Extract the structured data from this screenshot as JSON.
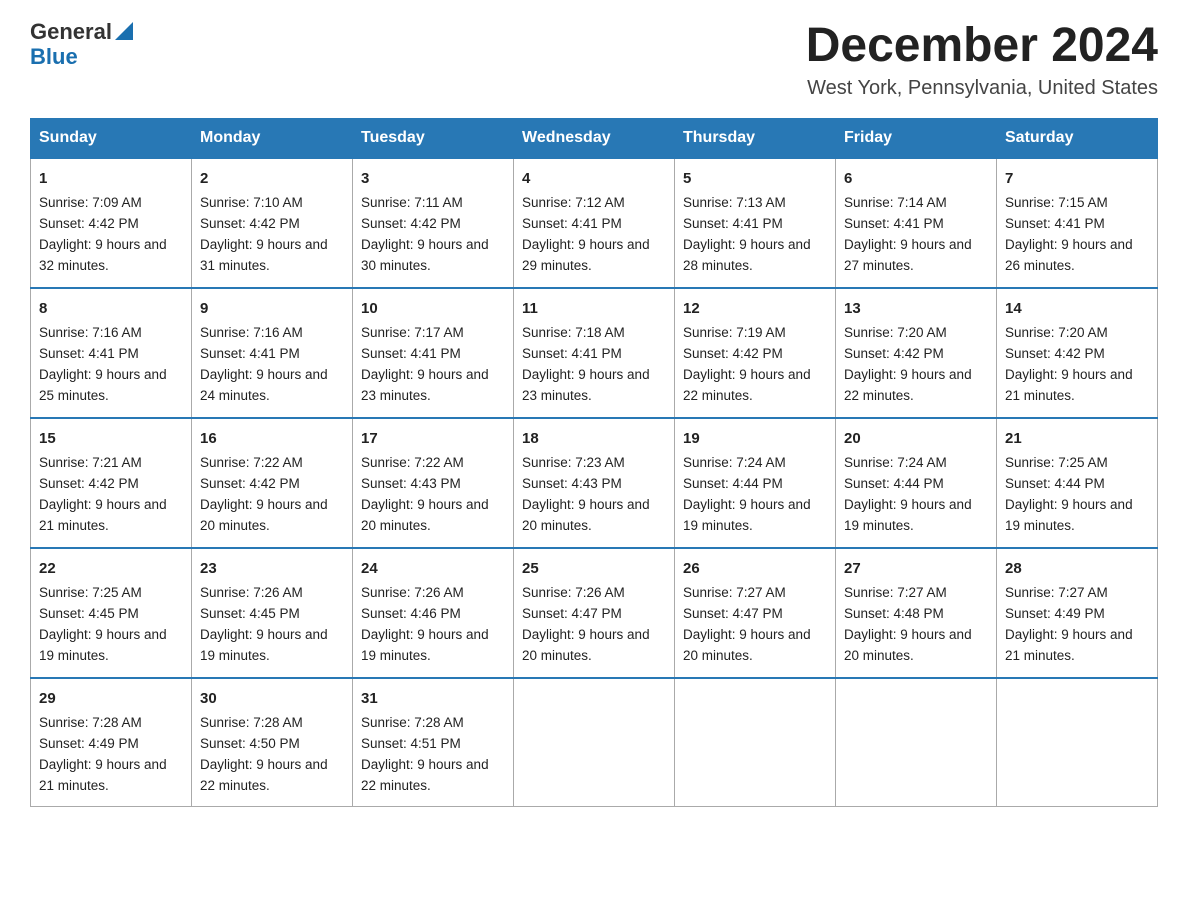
{
  "logo": {
    "text_general": "General",
    "text_blue": "Blue",
    "aria": "GeneralBlue logo"
  },
  "header": {
    "month_title": "December 2024",
    "location": "West York, Pennsylvania, United States"
  },
  "weekdays": [
    "Sunday",
    "Monday",
    "Tuesday",
    "Wednesday",
    "Thursday",
    "Friday",
    "Saturday"
  ],
  "weeks": [
    [
      {
        "day": "1",
        "sunrise": "7:09 AM",
        "sunset": "4:42 PM",
        "daylight": "9 hours and 32 minutes."
      },
      {
        "day": "2",
        "sunrise": "7:10 AM",
        "sunset": "4:42 PM",
        "daylight": "9 hours and 31 minutes."
      },
      {
        "day": "3",
        "sunrise": "7:11 AM",
        "sunset": "4:42 PM",
        "daylight": "9 hours and 30 minutes."
      },
      {
        "day": "4",
        "sunrise": "7:12 AM",
        "sunset": "4:41 PM",
        "daylight": "9 hours and 29 minutes."
      },
      {
        "day": "5",
        "sunrise": "7:13 AM",
        "sunset": "4:41 PM",
        "daylight": "9 hours and 28 minutes."
      },
      {
        "day": "6",
        "sunrise": "7:14 AM",
        "sunset": "4:41 PM",
        "daylight": "9 hours and 27 minutes."
      },
      {
        "day": "7",
        "sunrise": "7:15 AM",
        "sunset": "4:41 PM",
        "daylight": "9 hours and 26 minutes."
      }
    ],
    [
      {
        "day": "8",
        "sunrise": "7:16 AM",
        "sunset": "4:41 PM",
        "daylight": "9 hours and 25 minutes."
      },
      {
        "day": "9",
        "sunrise": "7:16 AM",
        "sunset": "4:41 PM",
        "daylight": "9 hours and 24 minutes."
      },
      {
        "day": "10",
        "sunrise": "7:17 AM",
        "sunset": "4:41 PM",
        "daylight": "9 hours and 23 minutes."
      },
      {
        "day": "11",
        "sunrise": "7:18 AM",
        "sunset": "4:41 PM",
        "daylight": "9 hours and 23 minutes."
      },
      {
        "day": "12",
        "sunrise": "7:19 AM",
        "sunset": "4:42 PM",
        "daylight": "9 hours and 22 minutes."
      },
      {
        "day": "13",
        "sunrise": "7:20 AM",
        "sunset": "4:42 PM",
        "daylight": "9 hours and 22 minutes."
      },
      {
        "day": "14",
        "sunrise": "7:20 AM",
        "sunset": "4:42 PM",
        "daylight": "9 hours and 21 minutes."
      }
    ],
    [
      {
        "day": "15",
        "sunrise": "7:21 AM",
        "sunset": "4:42 PM",
        "daylight": "9 hours and 21 minutes."
      },
      {
        "day": "16",
        "sunrise": "7:22 AM",
        "sunset": "4:42 PM",
        "daylight": "9 hours and 20 minutes."
      },
      {
        "day": "17",
        "sunrise": "7:22 AM",
        "sunset": "4:43 PM",
        "daylight": "9 hours and 20 minutes."
      },
      {
        "day": "18",
        "sunrise": "7:23 AM",
        "sunset": "4:43 PM",
        "daylight": "9 hours and 20 minutes."
      },
      {
        "day": "19",
        "sunrise": "7:24 AM",
        "sunset": "4:44 PM",
        "daylight": "9 hours and 19 minutes."
      },
      {
        "day": "20",
        "sunrise": "7:24 AM",
        "sunset": "4:44 PM",
        "daylight": "9 hours and 19 minutes."
      },
      {
        "day": "21",
        "sunrise": "7:25 AM",
        "sunset": "4:44 PM",
        "daylight": "9 hours and 19 minutes."
      }
    ],
    [
      {
        "day": "22",
        "sunrise": "7:25 AM",
        "sunset": "4:45 PM",
        "daylight": "9 hours and 19 minutes."
      },
      {
        "day": "23",
        "sunrise": "7:26 AM",
        "sunset": "4:45 PM",
        "daylight": "9 hours and 19 minutes."
      },
      {
        "day": "24",
        "sunrise": "7:26 AM",
        "sunset": "4:46 PM",
        "daylight": "9 hours and 19 minutes."
      },
      {
        "day": "25",
        "sunrise": "7:26 AM",
        "sunset": "4:47 PM",
        "daylight": "9 hours and 20 minutes."
      },
      {
        "day": "26",
        "sunrise": "7:27 AM",
        "sunset": "4:47 PM",
        "daylight": "9 hours and 20 minutes."
      },
      {
        "day": "27",
        "sunrise": "7:27 AM",
        "sunset": "4:48 PM",
        "daylight": "9 hours and 20 minutes."
      },
      {
        "day": "28",
        "sunrise": "7:27 AM",
        "sunset": "4:49 PM",
        "daylight": "9 hours and 21 minutes."
      }
    ],
    [
      {
        "day": "29",
        "sunrise": "7:28 AM",
        "sunset": "4:49 PM",
        "daylight": "9 hours and 21 minutes."
      },
      {
        "day": "30",
        "sunrise": "7:28 AM",
        "sunset": "4:50 PM",
        "daylight": "9 hours and 22 minutes."
      },
      {
        "day": "31",
        "sunrise": "7:28 AM",
        "sunset": "4:51 PM",
        "daylight": "9 hours and 22 minutes."
      },
      null,
      null,
      null,
      null
    ]
  ]
}
